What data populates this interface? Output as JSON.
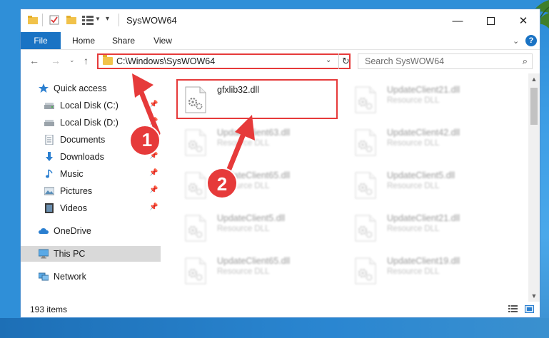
{
  "window": {
    "title": "SysWOW64"
  },
  "ribbon": {
    "tabs": [
      "File",
      "Home",
      "Share",
      "View"
    ]
  },
  "address": {
    "path": "C:\\Windows\\SysWOW64"
  },
  "search": {
    "placeholder": "Search SysWOW64"
  },
  "nav": {
    "items": [
      {
        "label": "Quick access",
        "icon": "star-icon",
        "pinned": false
      },
      {
        "label": "Local Disk (C:)",
        "icon": "drive-icon",
        "pinned": true
      },
      {
        "label": "Local Disk (D:)",
        "icon": "drive-icon",
        "pinned": true
      },
      {
        "label": "Documents",
        "icon": "documents-icon",
        "pinned": true
      },
      {
        "label": "Downloads",
        "icon": "download-icon",
        "pinned": true
      },
      {
        "label": "Music",
        "icon": "music-icon",
        "pinned": true
      },
      {
        "label": "Pictures",
        "icon": "pictures-icon",
        "pinned": true
      },
      {
        "label": "Videos",
        "icon": "videos-icon",
        "pinned": true
      },
      {
        "label": "OneDrive",
        "icon": "cloud-icon",
        "pinned": false
      },
      {
        "label": "This PC",
        "icon": "computer-icon",
        "pinned": false,
        "selected": true
      },
      {
        "label": "Network",
        "icon": "network-icon",
        "pinned": false
      }
    ]
  },
  "files": [
    {
      "name": "gfxlib32.dll",
      "type": "",
      "highlighted": true
    },
    {
      "name": "UpdateClient21.dll",
      "type": "Resource DLL"
    },
    {
      "name": "UpdateClient63.dll",
      "type": "Resource DLL"
    },
    {
      "name": "UpdateClient42.dll",
      "type": "Resource DLL"
    },
    {
      "name": "UpdateClient65.dll",
      "type": "Resource DLL"
    },
    {
      "name": "UpdateClient5.dll",
      "type": "Resource DLL"
    },
    {
      "name": "UpdateClient5.dll",
      "type": "Resource DLL"
    },
    {
      "name": "UpdateClient21.dll",
      "type": "Resource DLL"
    },
    {
      "name": "UpdateClient65.dll",
      "type": "Resource DLL"
    },
    {
      "name": "UpdateClient19.dll",
      "type": "Resource DLL"
    }
  ],
  "status": {
    "item_count": "193 items"
  },
  "annotations": {
    "step1": "1",
    "step2": "2"
  },
  "colors": {
    "accent": "#1a73c4",
    "annotation": "#e63a3a"
  }
}
